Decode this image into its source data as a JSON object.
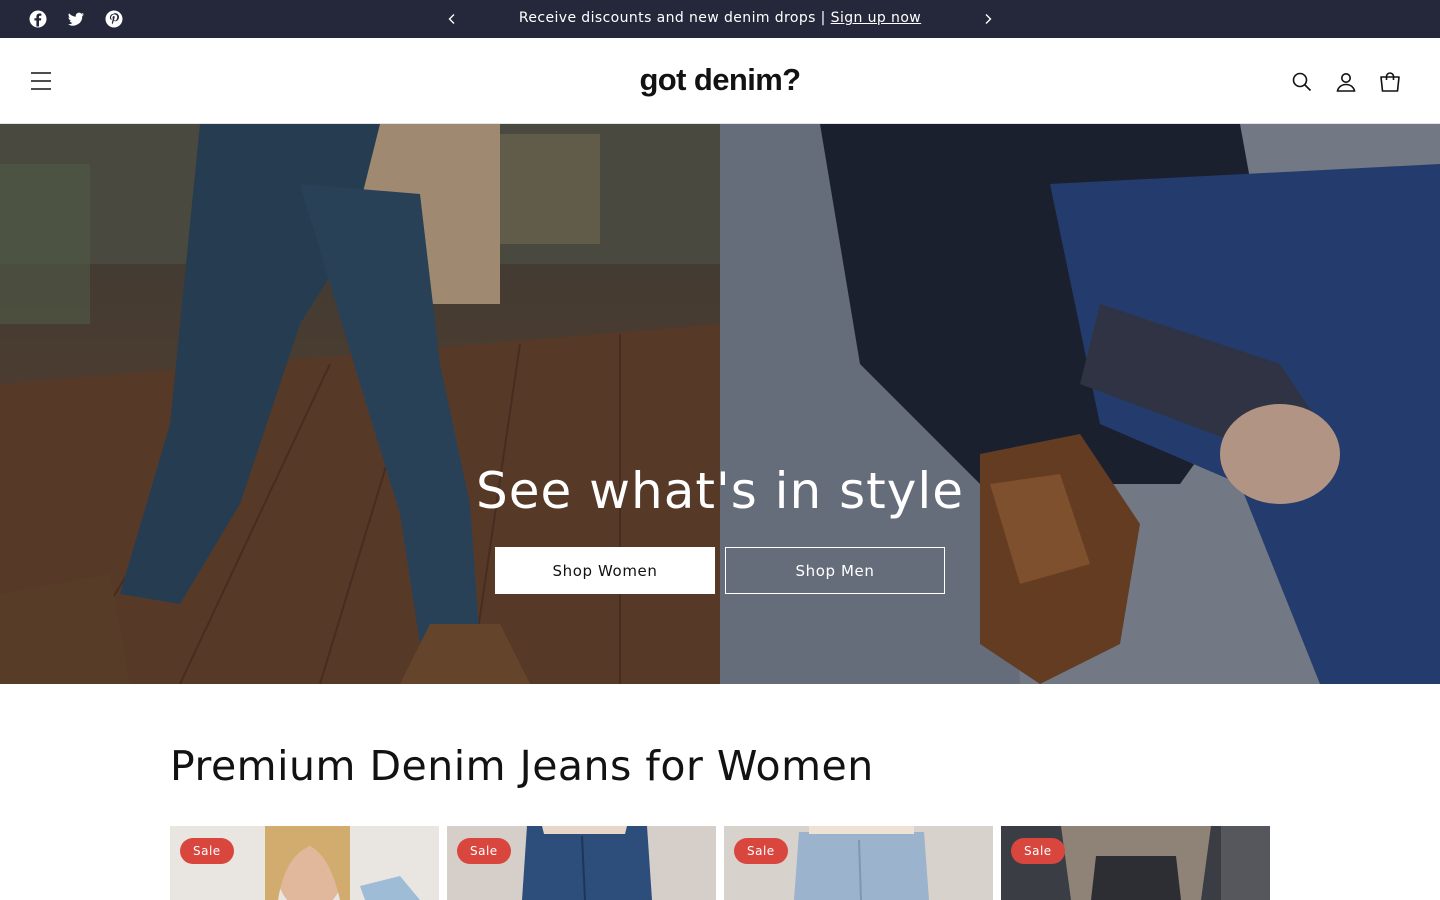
{
  "announcement": {
    "text": "Receive discounts and new denim drops | ",
    "link": "Sign up now",
    "social_icons": [
      "facebook-icon",
      "twitter-icon",
      "pinterest-icon"
    ]
  },
  "header": {
    "logo": "got denim?",
    "icons": [
      "menu-icon",
      "search-icon",
      "account-icon",
      "cart-icon"
    ]
  },
  "hero": {
    "title": "See what's in style",
    "buttons": [
      {
        "label": "Shop Women"
      },
      {
        "label": "Shop Men"
      }
    ]
  },
  "collection": {
    "title": "Premium Denim Jeans for Women",
    "products": [
      {
        "badge": "Sale"
      },
      {
        "badge": "Sale"
      },
      {
        "badge": "Sale"
      },
      {
        "badge": "Sale"
      }
    ]
  },
  "colors": {
    "announcement_bg": "#24283a",
    "sale_badge": "#d9463e",
    "text": "#121212"
  }
}
